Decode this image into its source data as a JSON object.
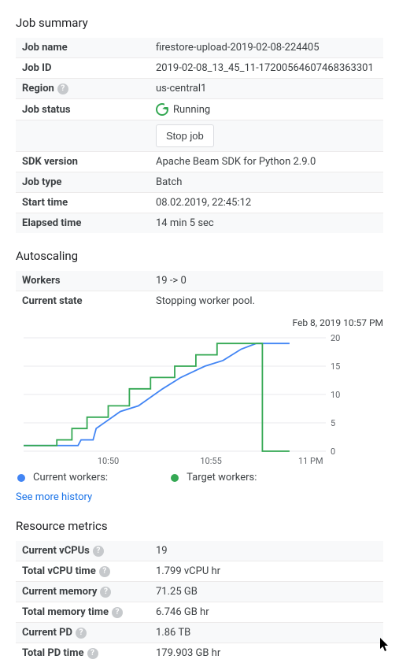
{
  "summary": {
    "title": "Job summary",
    "rows": [
      {
        "label": "Job name",
        "value": "firestore-upload-2019-02-08-224405"
      },
      {
        "label": "Job ID",
        "value": "2019-02-08_13_45_11-17200564607468363301"
      },
      {
        "label": "Region",
        "value": "us-central1",
        "help": true
      },
      {
        "label": "Job status",
        "value": "Running",
        "status": true
      },
      {
        "stopRow": true,
        "button": "Stop job"
      },
      {
        "label": "SDK version",
        "value": "Apache Beam SDK for Python 2.9.0"
      },
      {
        "label": "Job type",
        "value": "Batch"
      },
      {
        "label": "Start time",
        "value": "08.02.2019, 22:45:12"
      },
      {
        "label": "Elapsed time",
        "value": "14 min 5 sec"
      }
    ]
  },
  "autoscaling": {
    "title": "Autoscaling",
    "rows": [
      {
        "label": "Workers",
        "value": "19 -> 0"
      },
      {
        "label": "Current state",
        "value": "Stopping worker pool."
      }
    ]
  },
  "chart_meta": {
    "timestamp": "Feb 8, 2019 10:57 PM",
    "legend": {
      "current": "Current workers:",
      "target": "Target workers:"
    },
    "more_link": "See more history"
  },
  "chart_data": {
    "type": "line",
    "xlabel": "",
    "ylabel": "",
    "xlim_labels": [
      "10:50",
      "10:55",
      "11 PM"
    ],
    "ylim": [
      0,
      20
    ],
    "yticks": [
      0,
      5,
      10,
      15,
      20
    ],
    "series": [
      {
        "name": "Current workers",
        "color": "#4285f4",
        "points": [
          {
            "t": 0.0,
            "v": 1
          },
          {
            "t": 0.18,
            "v": 1
          },
          {
            "t": 0.19,
            "v": 2
          },
          {
            "t": 0.23,
            "v": 2
          },
          {
            "t": 0.24,
            "v": 4
          },
          {
            "t": 0.32,
            "v": 7
          },
          {
            "t": 0.38,
            "v": 8
          },
          {
            "t": 0.46,
            "v": 11
          },
          {
            "t": 0.52,
            "v": 13
          },
          {
            "t": 0.6,
            "v": 15
          },
          {
            "t": 0.66,
            "v": 16
          },
          {
            "t": 0.72,
            "v": 18
          },
          {
            "t": 0.77,
            "v": 19
          },
          {
            "t": 0.88,
            "v": 19
          }
        ]
      },
      {
        "name": "Target workers",
        "color": "#34a853",
        "points": [
          {
            "t": 0.0,
            "v": 1
          },
          {
            "t": 0.11,
            "v": 1
          },
          {
            "t": 0.11,
            "v": 2
          },
          {
            "t": 0.16,
            "v": 2
          },
          {
            "t": 0.16,
            "v": 4
          },
          {
            "t": 0.21,
            "v": 4
          },
          {
            "t": 0.21,
            "v": 6
          },
          {
            "t": 0.28,
            "v": 6
          },
          {
            "t": 0.28,
            "v": 8
          },
          {
            "t": 0.35,
            "v": 8
          },
          {
            "t": 0.35,
            "v": 11
          },
          {
            "t": 0.42,
            "v": 11
          },
          {
            "t": 0.42,
            "v": 13
          },
          {
            "t": 0.5,
            "v": 13
          },
          {
            "t": 0.5,
            "v": 15
          },
          {
            "t": 0.57,
            "v": 15
          },
          {
            "t": 0.57,
            "v": 17
          },
          {
            "t": 0.64,
            "v": 17
          },
          {
            "t": 0.64,
            "v": 19
          },
          {
            "t": 0.79,
            "v": 19
          },
          {
            "t": 0.79,
            "v": 0
          },
          {
            "t": 0.88,
            "v": 0
          }
        ]
      }
    ]
  },
  "resources": {
    "title": "Resource metrics",
    "rows": [
      {
        "label": "Current vCPUs",
        "value": "19",
        "help": true
      },
      {
        "label": "Total vCPU time",
        "value": "1.799 vCPU hr",
        "help": true
      },
      {
        "label": "Current memory",
        "value": "71.25 GB",
        "help": true
      },
      {
        "label": "Total memory time",
        "value": "6.746 GB hr",
        "help": true
      },
      {
        "label": "Current PD",
        "value": "1.86 TB",
        "help": true
      },
      {
        "label": "Total PD time",
        "value": "179.903 GB hr",
        "help": true
      }
    ]
  }
}
